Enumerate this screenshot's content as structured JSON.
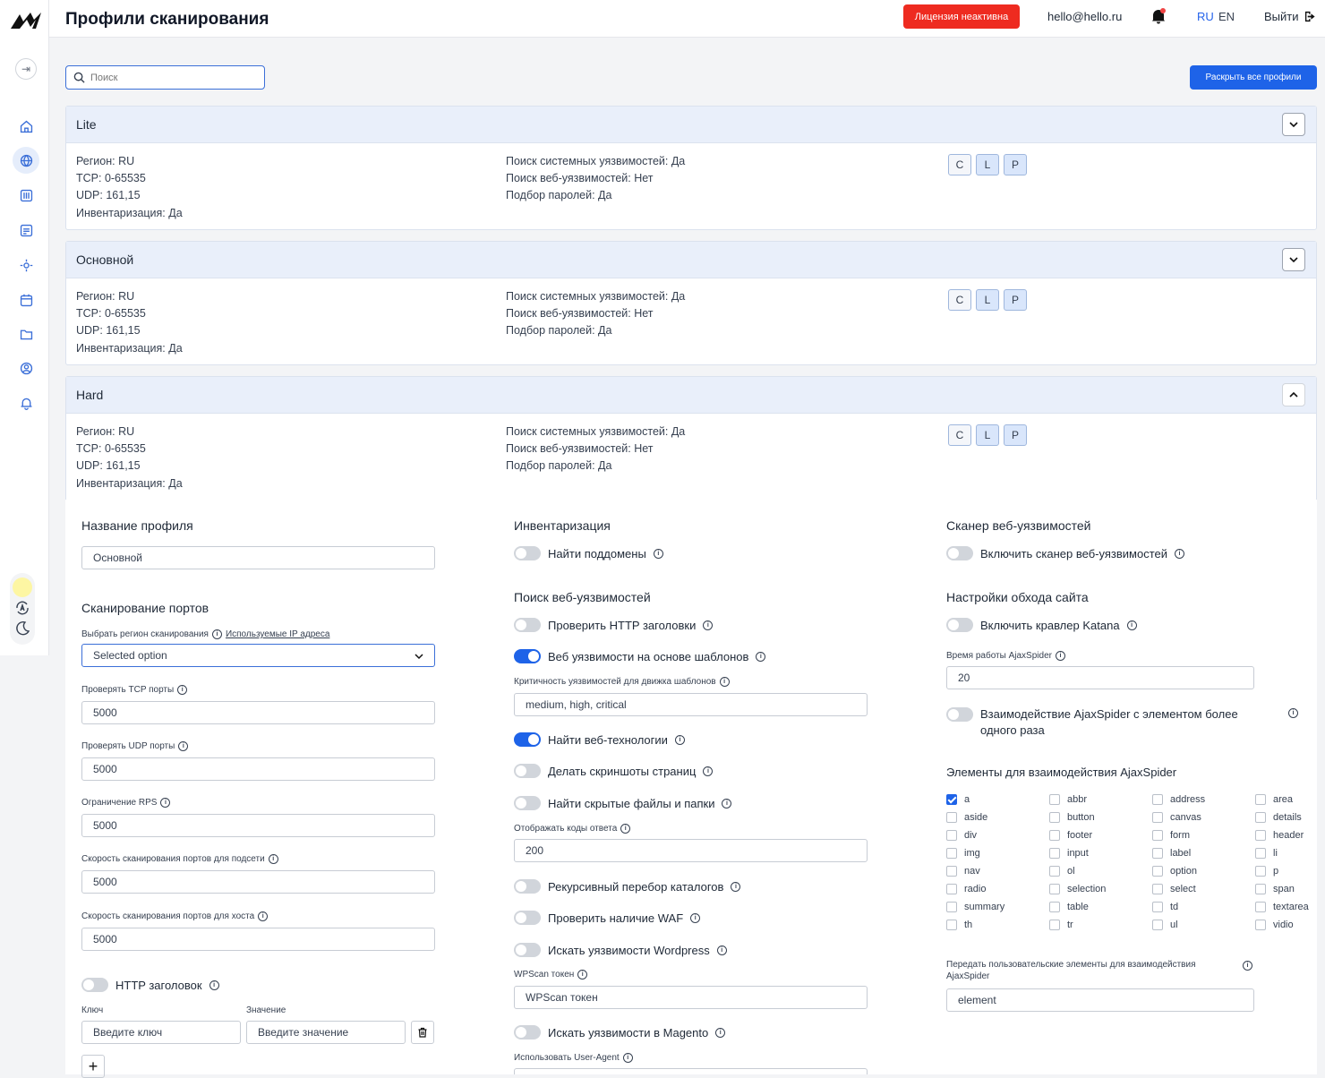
{
  "header": {
    "title": "Профили сканирования",
    "license_badge": "Лицензия неактивна",
    "email": "hello@hello.ru",
    "lang_ru": "RU",
    "lang_en": "EN",
    "logout": "Выйти"
  },
  "toolbar": {
    "search_placeholder": "Поиск",
    "expand_all": "Раскрыть все профили"
  },
  "colors": {
    "accent": "#1e63e8",
    "danger": "#ee2b20",
    "profile_header": "#e9effa"
  },
  "profiles": [
    {
      "name": "Lite",
      "region": "Регион: RU",
      "tcp": "TCP: 0-65535",
      "udp": "UDP: 161,15",
      "inventory": "Инвентаризация: Да",
      "sys_vuln": "Поиск системных уязвимостей: Да",
      "web_vuln": "Поиск веб-уязвимостей: Нет",
      "passwords": "Подбор паролей: Да",
      "tags": [
        "C",
        "L",
        "P"
      ],
      "expanded": false
    },
    {
      "name": "Основной",
      "region": "Регион: RU",
      "tcp": "TCP: 0-65535",
      "udp": "UDP: 161,15",
      "inventory": "Инвентаризация: Да",
      "sys_vuln": "Поиск системных уязвимостей: Да",
      "web_vuln": "Поиск веб-уязвимостей: Нет",
      "passwords": "Подбор паролей: Да",
      "tags": [
        "C",
        "L",
        "P"
      ],
      "expanded": false
    },
    {
      "name": "Hard",
      "region": "Регион: RU",
      "tcp": "TCP: 0-65535",
      "udp": "UDP: 161,15",
      "inventory": "Инвентаризация: Да",
      "sys_vuln": "Поиск системных уязвимостей: Да",
      "web_vuln": "Поиск веб-уязвимостей: Нет",
      "passwords": "Подбор паролей: Да",
      "tags": [
        "C",
        "L",
        "P"
      ],
      "expanded": true
    }
  ],
  "editor": {
    "col1": {
      "name_title": "Название профиля",
      "name_value": "Основной",
      "ports_title": "Сканирование портов",
      "region_label": "Выбрать регион сканирования",
      "region_link": "Используемые IP адреса",
      "region_value": "Selected option",
      "tcp_label": "Проверять TCP порты",
      "tcp_value": "5000",
      "udp_label": "Проверять UDP порты",
      "udp_value": "5000",
      "rps_label": "Ограничение RPS",
      "rps_value": "5000",
      "subnet_label": "Скорость сканирования портов для подсети",
      "subnet_value": "5000",
      "host_label": "Скорость сканирования портов для хоста",
      "host_value": "5000",
      "http_header_toggle": "HTTP заголовок",
      "key_label": "Ключ",
      "value_label": "Значение",
      "key_placeholder": "Введите ключ",
      "value_placeholder": "Введите значение"
    },
    "col2": {
      "inventory_title": "Инвентаризация",
      "subdomains": "Найти поддомены",
      "webvuln_title": "Поиск веб-уязвимостей",
      "http_headers": "Проверить HTTP заголовки",
      "templates": "Веб уязвимости на основе шаблонов",
      "severity_label": "Критичность уязвимостей для движка шаблонов",
      "severity_value": "medium, high, critical",
      "webtech": "Найти веб-технологии",
      "screenshots": "Делать скриншоты страниц",
      "hidden_files": "Найти скрытые файлы и папки",
      "codes_label": "Отображать коды ответа",
      "codes_value": "200",
      "recursive": "Рекурсивный перебор каталогов",
      "waf": "Проверить наличие WAF",
      "wordpress": "Искать уязвимости Wordpress",
      "wpscan_label": "WPScan токен",
      "wpscan_placeholder": "WPScan токен",
      "magento": "Искать уязвимости в Magento",
      "useragent_label": "Использовать User-Agent"
    },
    "col3": {
      "scanner_title": "Сканер веб-уязвимостей",
      "scanner_toggle": "Включить сканер веб-уязвимостей",
      "crawl_title": "Настройки обхода сайта",
      "katana": "Включить кравлер Katana",
      "ajax_time_label": "Время работы AjaxSpider",
      "ajax_time_value": "20",
      "ajax_repeat_line1": "Взаимодействие AjaxSpider с элементом более",
      "ajax_repeat_line2": "одного раза",
      "elements_title": "Элементы для взаимодействия AjaxSpider",
      "elements": [
        "a",
        "abbr",
        "address",
        "area",
        "aside",
        "button",
        "canvas",
        "details",
        "div",
        "footer",
        "form",
        "header",
        "img",
        "input",
        "label",
        "li",
        "nav",
        "ol",
        "option",
        "p",
        "radio",
        "selection",
        "select",
        "span",
        "summary",
        "table",
        "td",
        "textarea",
        "th",
        "tr",
        "ul",
        "vidio"
      ],
      "custom_label_line1": "Передать пользовательские элементы для взаимодействия",
      "custom_label_line2": "AjaxSpider",
      "custom_value": "element"
    }
  }
}
